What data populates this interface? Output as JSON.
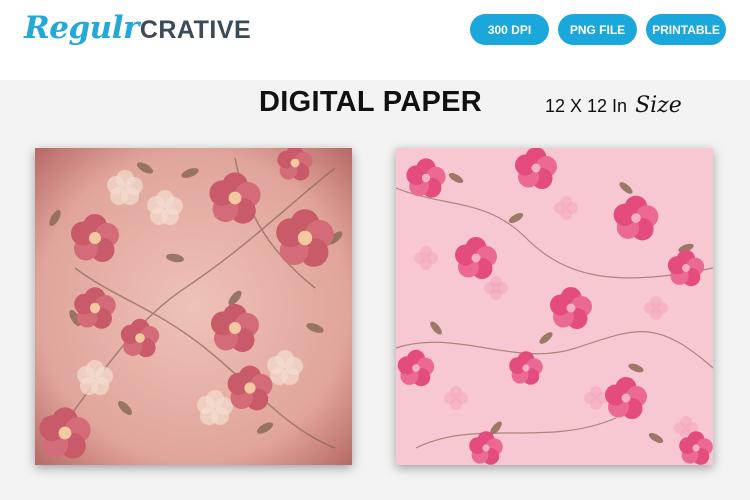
{
  "header": {
    "logo_script": "Regulr",
    "logo_bold": "CRATIVE",
    "badges": [
      "300 DPI",
      "PNG FILE",
      "PRINTABLE"
    ]
  },
  "main": {
    "title": "DIGITAL PAPER",
    "size_text": "12 X 12 In",
    "size_script": "Size"
  },
  "papers": [
    {
      "name": "vintage-pink-floral",
      "base": "#e3a9a0",
      "flower": "#c95a6a",
      "leaf": "#8a6a58",
      "accent": "#f3ddd0"
    },
    {
      "name": "bright-pink-floral",
      "base": "#f7c8d2",
      "flower": "#e34c7d",
      "leaf": "#8c6a55",
      "accent": "#f3a9bd"
    }
  ]
}
